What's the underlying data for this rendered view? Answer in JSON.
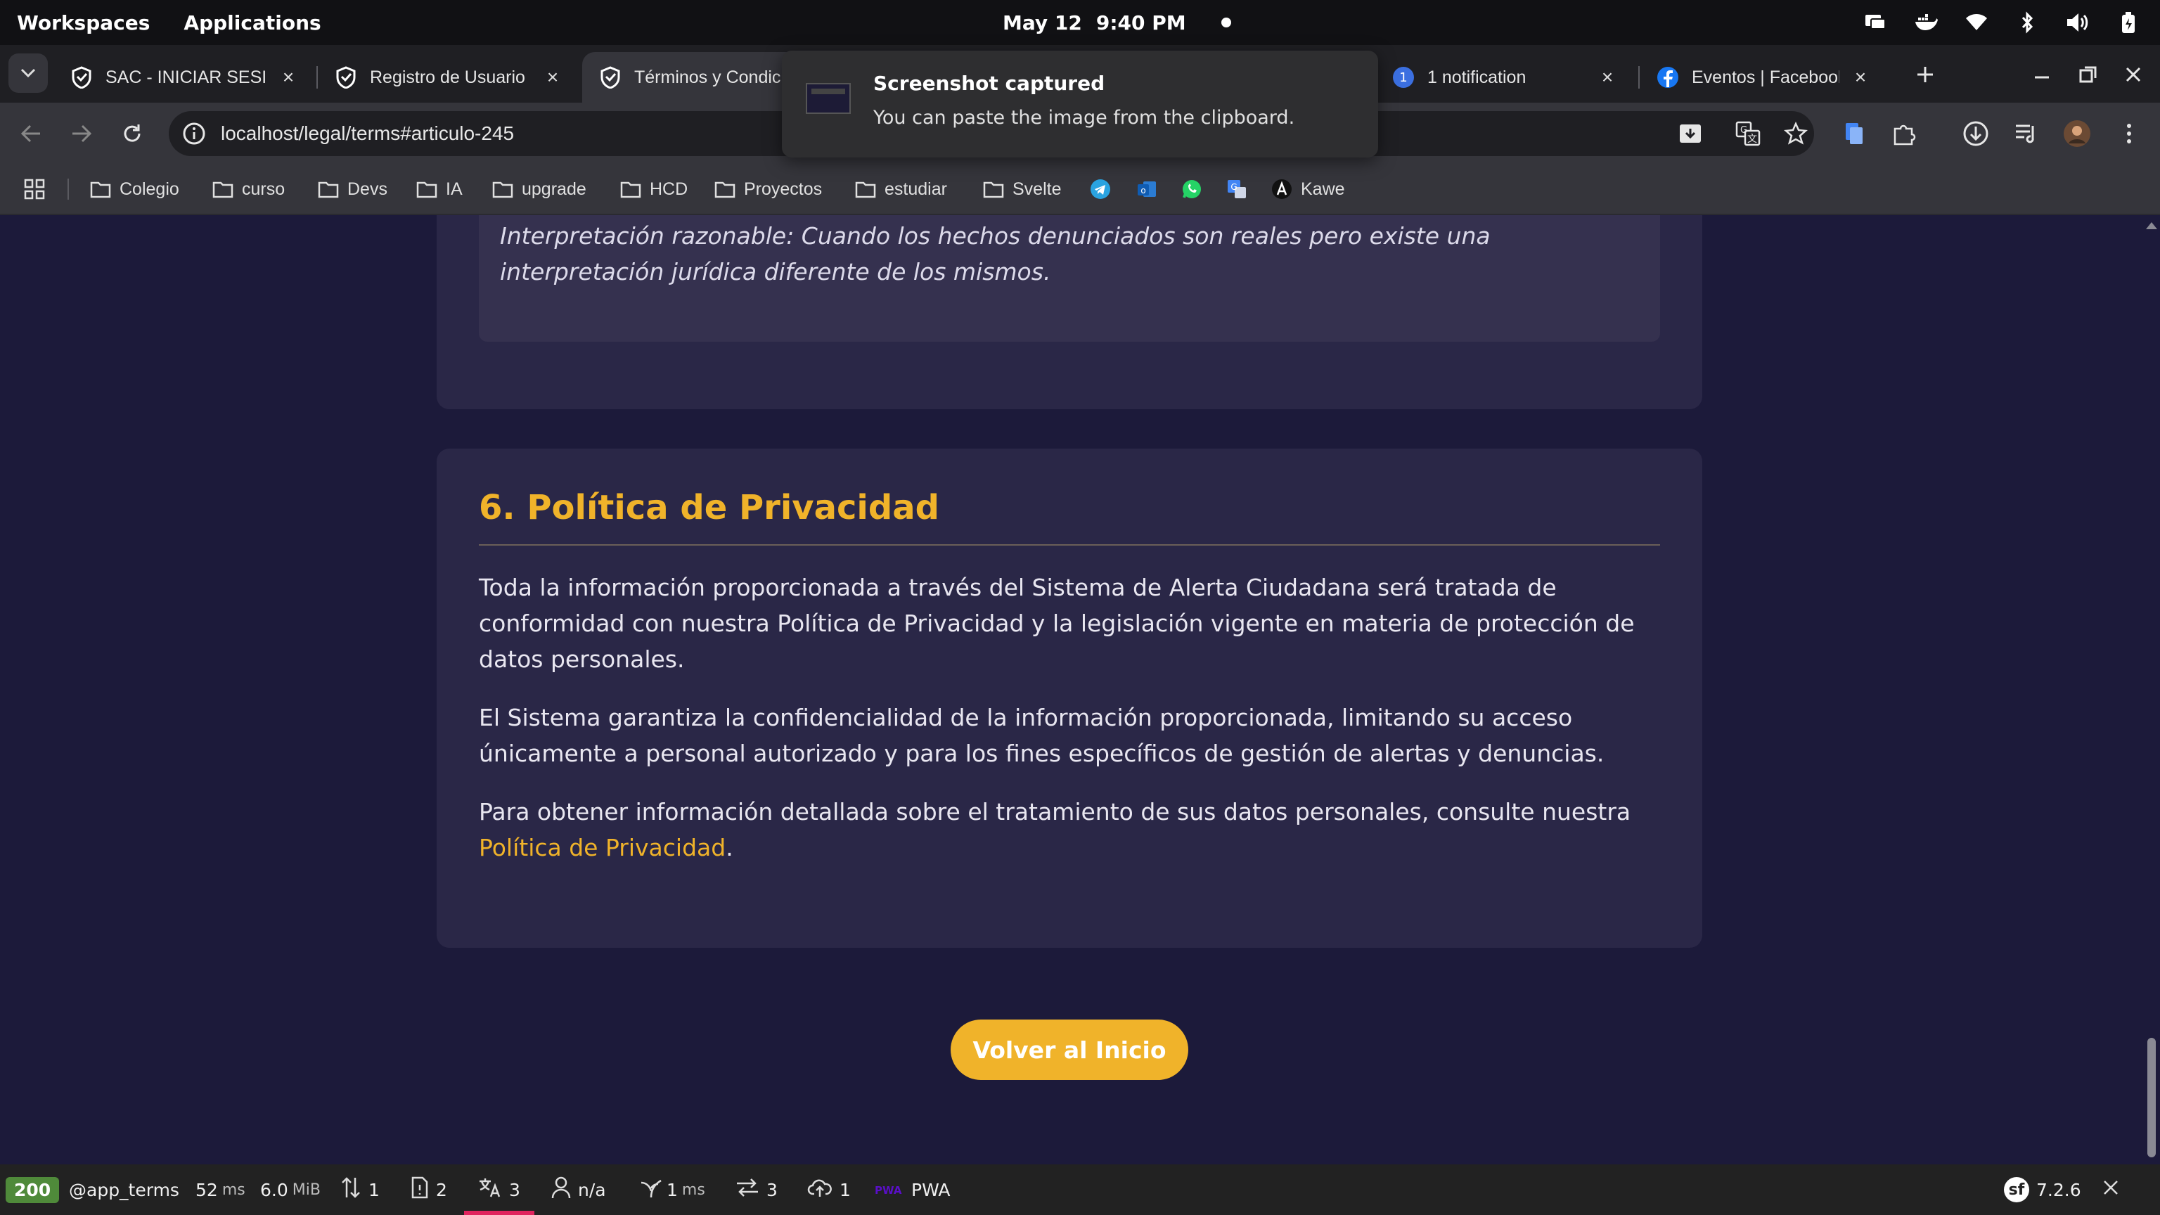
{
  "topbar": {
    "workspaces": "Workspaces",
    "applications": "Applications",
    "date": "May 12",
    "time": "9:40 PM"
  },
  "tabs": [
    {
      "title": "SAC - INICIAR SESIÓN",
      "favicon": "shield-icon"
    },
    {
      "title": "Registro de Usuario",
      "favicon": "shield-icon"
    },
    {
      "title": "Términos y Condiciones",
      "favicon": "shield-icon",
      "active": true
    },
    {
      "title": "1 notification",
      "favicon": "notification-badge-icon",
      "badge": "1"
    },
    {
      "title": "Eventos | Facebook",
      "favicon": "facebook-icon"
    }
  ],
  "omnibox": {
    "url": "localhost/legal/terms#articulo-245"
  },
  "bookmarks": [
    "Colegio",
    "curso",
    "Devs",
    "IA",
    "upgrade",
    "HCD",
    "Proyectos",
    "estudiar",
    "Svelte"
  ],
  "bookmark_kawe": "Kawe",
  "toast": {
    "title": "Screenshot captured",
    "body": "You can paste the image from the clipboard."
  },
  "page": {
    "note": "Interpretación razonable: Cuando los hechos denunciados son reales pero existe una interpretación jurídica diferente de los mismos.",
    "section_title": "6. Política de Privacidad",
    "p1": "Toda la información proporcionada a través del Sistema de Alerta Ciudadana será tratada de conformidad con nuestra Política de Privacidad y la legislación vigente en materia de protección de datos personales.",
    "p2": "El Sistema garantiza la confidencialidad de la información proporcionada, limitando su acceso únicamente a personal autorizado y para los fines específicos de gestión de alertas y denuncias.",
    "p3": "Para obtener información detallada sobre el tratamiento de sus datos personales, consulte nuestra",
    "p3_link": "Política de Privacidad",
    "p3_end": ".",
    "home_button": "Volver al Inicio"
  },
  "debugbar": {
    "status": "200",
    "route": "@app_terms",
    "time_value": "52",
    "time_unit": "ms",
    "memory_value": "6.0",
    "memory_unit": "MiB",
    "requests": "1",
    "forms": "2",
    "translations": "3",
    "user": "n/a",
    "twig_value": "1",
    "twig_unit": "ms",
    "events": "3",
    "cache": "1",
    "pwa": "PWA",
    "version": "7.2.6"
  },
  "colors": {
    "accent": "#f0b32a",
    "page_bg": "#1c1a3a",
    "card_bg": "#2a2747"
  }
}
